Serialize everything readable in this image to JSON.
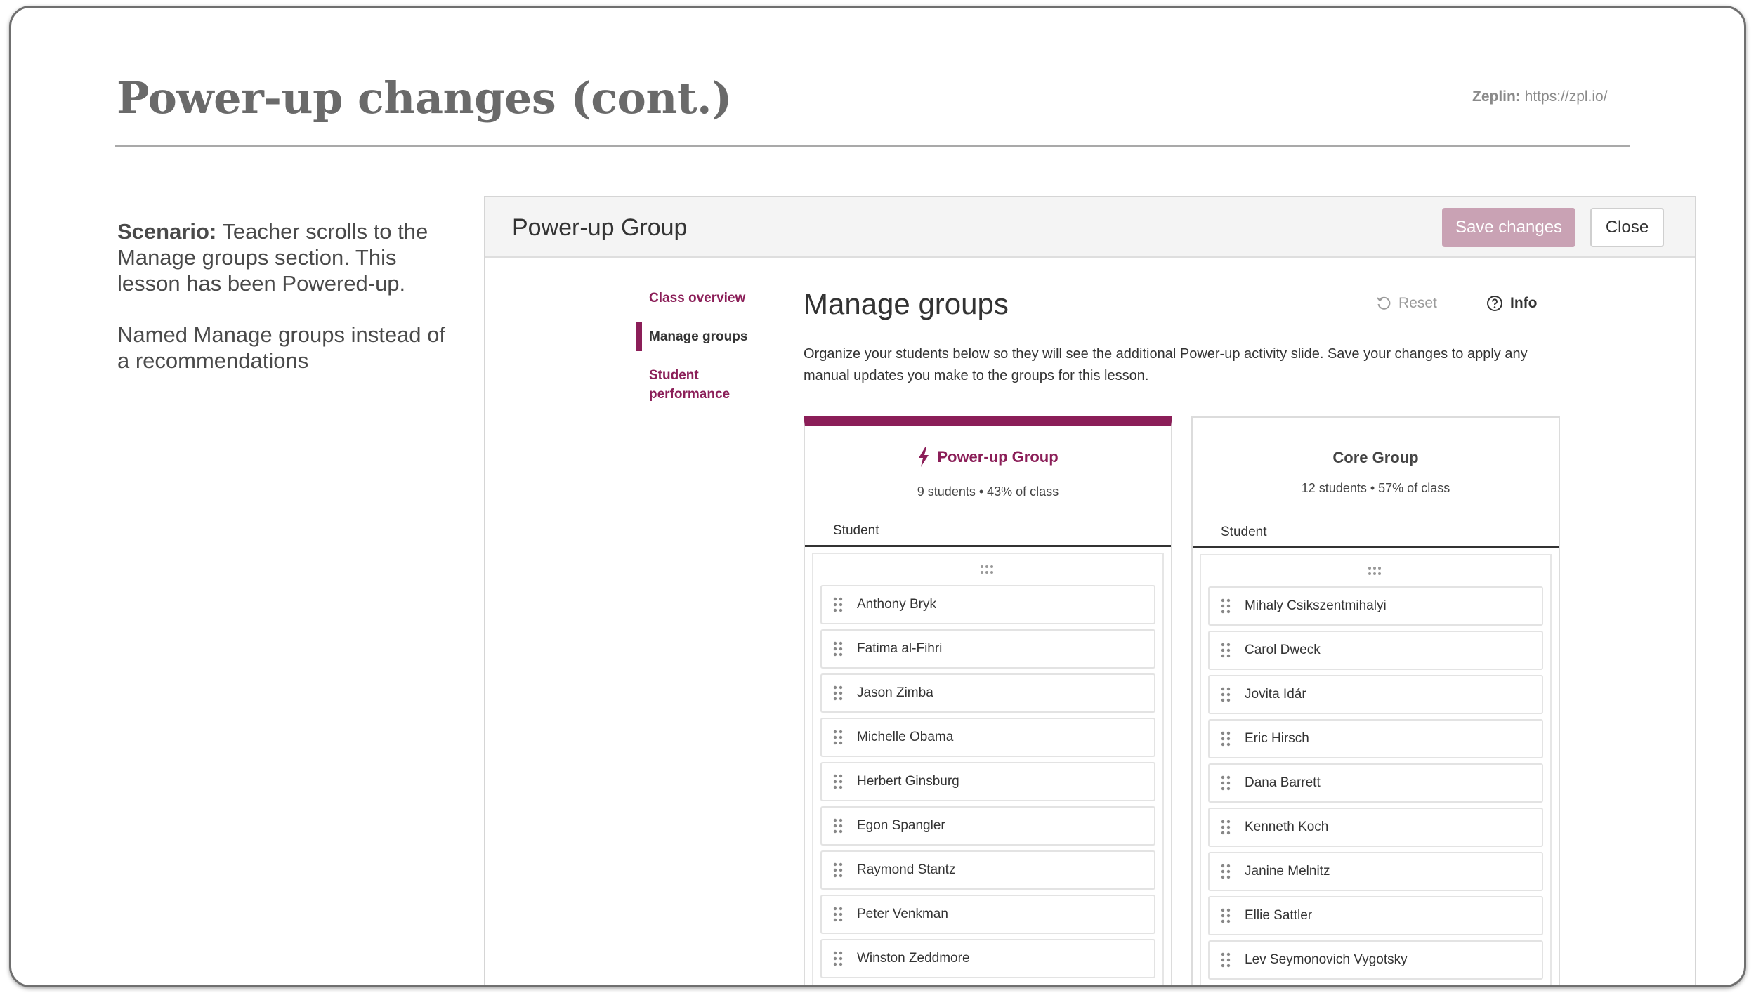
{
  "slide": {
    "title": "Power-up changes (cont.)",
    "zeplin_label": "Zeplin:",
    "zeplin_url": "https://zpl.io/"
  },
  "scenario": {
    "lead": "Scenario:",
    "text": "Teacher scrolls to the Manage groups section. This lesson has been Powered-up.",
    "note": "Named Manage groups instead of a recommendations"
  },
  "app": {
    "title": "Power-up Group",
    "save_label": "Save changes",
    "close_label": "Close"
  },
  "nav": {
    "items": [
      {
        "label": "Class overview"
      },
      {
        "label": "Manage groups"
      },
      {
        "label": "Student performance"
      }
    ],
    "active": "Manage groups"
  },
  "main": {
    "title": "Manage groups",
    "reset_label": "Reset",
    "info_label": "Info",
    "description": "Organize your students below so they will see the additional Power-up activity slide. Save your changes to apply any manual updates you make to the groups for this lesson."
  },
  "groups": [
    {
      "name": "Power-up Group",
      "stats": "9 students  •  43% of class",
      "column": "Student",
      "students": [
        "Anthony Bryk",
        "Fatima al-Fihri",
        "Jason Zimba",
        "Michelle Obama",
        "Herbert Ginsburg",
        "Egon Spangler",
        "Raymond Stantz",
        "Peter Venkman",
        "Winston Zeddmore"
      ]
    },
    {
      "name": "Core Group",
      "stats": "12 students  •  57% of class",
      "column": "Student",
      "students": [
        "Mihaly Csikszentmihalyi",
        "Carol Dweck",
        "Jovita Idár",
        "Eric Hirsch",
        "Dana Barrett",
        "Kenneth Koch",
        "Janine Melnitz",
        "Ellie Sattler",
        "Lev Seymonovich Vygotsky"
      ]
    }
  ],
  "colors": {
    "brand": "#8b1e58",
    "save_disabled": "#c9a2b4",
    "title_gray": "#6a6a6a"
  }
}
